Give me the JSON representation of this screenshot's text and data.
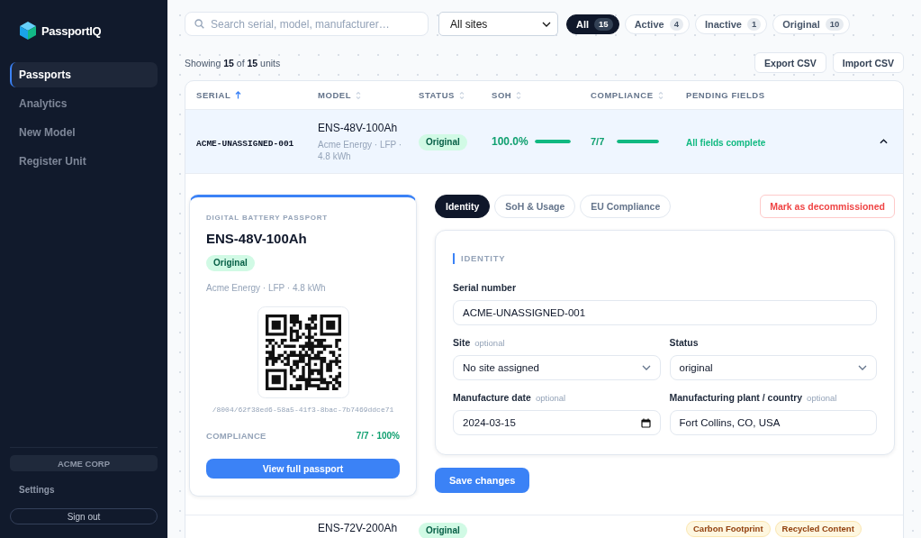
{
  "sidebar": {
    "brand": "PassportIQ",
    "nav": [
      {
        "label": "Passports",
        "selected": true
      },
      {
        "label": "Analytics",
        "selected": false
      },
      {
        "label": "New Model",
        "selected": false
      },
      {
        "label": "Register Unit",
        "selected": false
      }
    ],
    "org": "ACME CORP",
    "settings": "Settings",
    "sign_out": "Sign out"
  },
  "toolbar": {
    "search": {
      "placeholder": "Search serial, model, manufacturer…"
    },
    "site_filter": {
      "value": "All sites"
    },
    "status_filters": [
      {
        "label": "All",
        "count": "15",
        "selected": true
      },
      {
        "label": "Active",
        "count": "4",
        "selected": false
      },
      {
        "label": "Inactive",
        "count": "1",
        "selected": false
      },
      {
        "label": "Original",
        "count": "10",
        "selected": false
      }
    ]
  },
  "summary": "Showing **15** of **15** units",
  "actions": [
    "Export CSV",
    "Import CSV"
  ],
  "table": {
    "columns": [
      {
        "label": "SERIAL",
        "sortable": true,
        "sorted": true
      },
      {
        "label": "MODEL",
        "sortable": true,
        "sorted": false
      },
      {
        "label": "STATUS",
        "sortable": true,
        "sorted": false
      },
      {
        "label": "SOH",
        "sortable": true,
        "sorted": false
      },
      {
        "label": "COMPLIANCE",
        "sortable": true,
        "sorted": false
      },
      {
        "label": "PENDING FIELDS",
        "sortable": false
      }
    ],
    "rows": [
      {
        "serial": "ACME-UNASSIGNED-001",
        "model": "ENS-48V-100Ah",
        "model_details": "Acme Energy · LFP · 4.8 kWh",
        "status": "Original",
        "soh": {
          "reading": "100.0%",
          "level": 1
        },
        "compliance": {
          "reading": "7/7",
          "level": 1
        },
        "pending": {
          "kind": "complete",
          "text": "All fields complete"
        },
        "expanded": true,
        "detail": {
          "passport": {
            "eyebrow": "DIGITAL BATTERY PASSPORT",
            "model": "ENS-48V-100Ah",
            "status": "Original",
            "specs": "Acme Energy · LFP · 4.8 kWh",
            "link": "/8004/62f38ed6-58a5-41f3-8bac-7b7469ddce71",
            "compliance_label": "COMPLIANCE",
            "compliance_value": "7/7 · 100%",
            "button": "View full passport"
          },
          "tabs": [
            {
              "label": "Identity",
              "selected": true
            },
            {
              "label": "SoH & Usage",
              "selected": false
            },
            {
              "label": "EU Compliance",
              "selected": false
            }
          ],
          "decommission": "Mark as decommissioned",
          "section": {
            "title": "IDENTITY",
            "fields": [
              {
                "label": "Serial number",
                "kind": "text",
                "value": "ACME-UNASSIGNED-001"
              },
              {
                "label": "Site",
                "hint": "optional",
                "kind": "select",
                "value": "No site assigned"
              },
              {
                "label": "Status",
                "kind": "select",
                "value": "original"
              },
              {
                "label": "Manufacture date",
                "hint": "optional",
                "kind": "date",
                "value": "2024-03-15"
              },
              {
                "label": "Manufacturing plant / country",
                "hint": "optional",
                "kind": "text",
                "value": "Fort Collins, CO, USA"
              }
            ]
          },
          "save": "Save changes"
        }
      },
      {
        "model": "ENS-72V-200Ah",
        "status": "Original",
        "pending": {
          "kind": "tags",
          "tags": [
            "Carbon Footprint",
            "Recycled Content"
          ]
        },
        "expanded": false
      }
    ]
  }
}
